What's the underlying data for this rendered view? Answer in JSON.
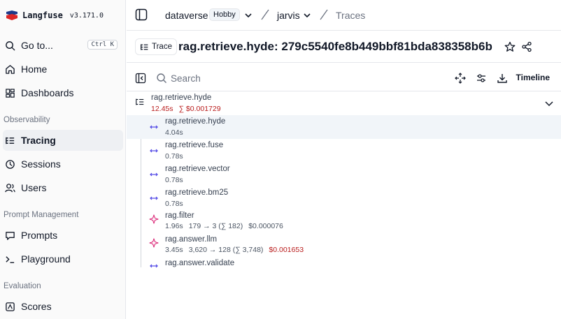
{
  "brand": {
    "name": "Langfuse",
    "version": "v3.171.0"
  },
  "sidebar": {
    "goto": {
      "label": "Go to...",
      "shortcut": "Ctrl K"
    },
    "items": [
      {
        "label": "Home",
        "icon": "home-icon"
      },
      {
        "label": "Dashboards",
        "icon": "dashboard-icon"
      }
    ],
    "sections": [
      {
        "title": "Observability",
        "items": [
          {
            "label": "Tracing",
            "icon": "tracing-icon",
            "active": true
          },
          {
            "label": "Sessions",
            "icon": "sessions-icon"
          },
          {
            "label": "Users",
            "icon": "users-icon"
          }
        ]
      },
      {
        "title": "Prompt Management",
        "items": [
          {
            "label": "Prompts",
            "icon": "prompts-icon"
          },
          {
            "label": "Playground",
            "icon": "terminal-icon"
          }
        ]
      },
      {
        "title": "Evaluation",
        "items": [
          {
            "label": "Scores",
            "icon": "scores-icon"
          }
        ]
      }
    ]
  },
  "breadcrumb": {
    "org": "dataverse",
    "plan": "Hobby",
    "project": "jarvis",
    "page": "Traces"
  },
  "trace": {
    "chip_label": "Trace",
    "title": "rag.retrieve.hyde: 279c5540fe8b449bbf81bda838358b6b"
  },
  "toolbar": {
    "search_placeholder": "Search",
    "timeline_label": "Timeline"
  },
  "tree": {
    "root": {
      "name": "rag.retrieve.hyde",
      "duration": "12.45s",
      "cost": "∑ $0.001729"
    },
    "children": [
      {
        "name": "rag.retrieve.hyde",
        "duration": "4.04s",
        "type": "span"
      },
      {
        "name": "rag.retrieve.fuse",
        "duration": "0.78s",
        "type": "span"
      },
      {
        "name": "rag.retrieve.vector",
        "duration": "0.78s",
        "type": "span"
      },
      {
        "name": "rag.retrieve.bm25",
        "duration": "0.78s",
        "type": "span"
      },
      {
        "name": "rag.filter",
        "duration": "1.96s",
        "tokens": "179 → 3 (∑ 182)",
        "cost": "$0.000076",
        "type": "generation"
      },
      {
        "name": "rag.answer.llm",
        "duration": "3.45s",
        "tokens": "3,620 → 128 (∑ 3,748)",
        "cost": "$0.001653",
        "type": "generation"
      },
      {
        "name": "rag.answer.validate",
        "type": "span"
      }
    ]
  },
  "colors": {
    "span_icon": "#4f46e5",
    "generation_icon": "#db2777",
    "cost": "#b91c1c"
  }
}
